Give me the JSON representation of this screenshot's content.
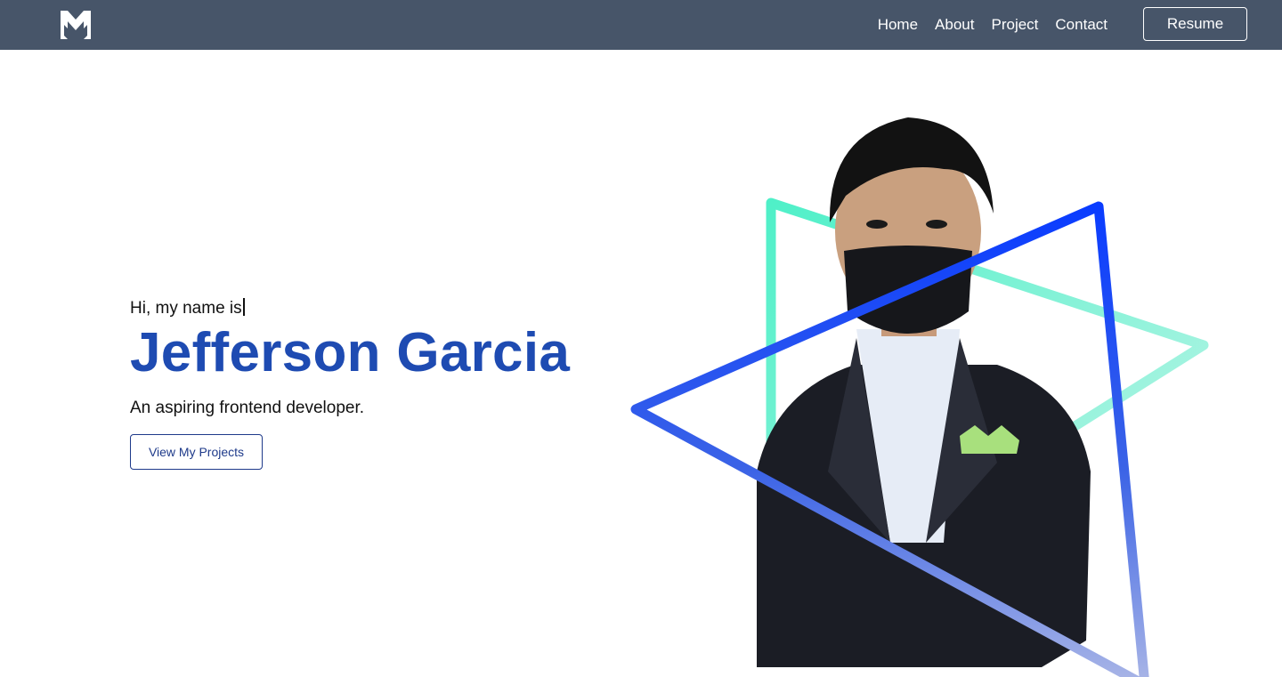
{
  "nav": {
    "logo_icon": "mv-monogram-logo",
    "links": [
      "Home",
      "About",
      "Project",
      "Contact"
    ],
    "resume_label": "Resume"
  },
  "hero": {
    "greeting": "Hi, my name is",
    "name": "Jefferson Garcia",
    "tagline": "An aspiring frontend developer.",
    "cta_label": "View My Projects"
  },
  "colors": {
    "navbar": "#475569",
    "accent": "#1e4bb2",
    "triangle_blue": "#0a3cff",
    "triangle_teal": "#4ff0c8"
  }
}
